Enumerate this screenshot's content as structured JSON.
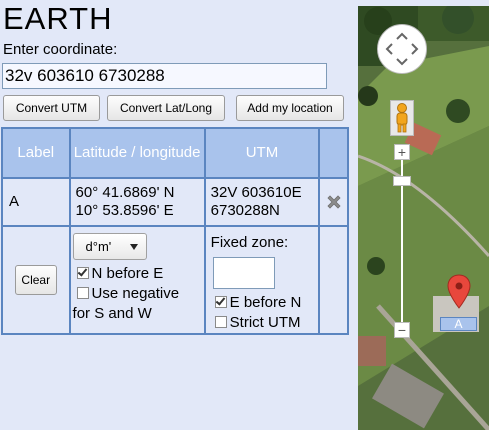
{
  "title": "EARTH",
  "prompt": "Enter coordinate:",
  "coordinate_input": {
    "value": "32v 603610 6730288"
  },
  "buttons": {
    "convert_utm": "Convert UTM",
    "convert_latlong": "Convert Lat/Long",
    "add_location": "Add my location"
  },
  "table": {
    "headers": {
      "label": "Label",
      "latlong": "Latitude / longitude",
      "utm": "UTM"
    },
    "row": {
      "label": "A",
      "lat": "60° 41.6869' N",
      "lon": "10° 53.8596' E",
      "utm_line1": "32V 603610E",
      "utm_line2": "6730288N"
    },
    "options": {
      "clear": "Clear",
      "format_selected": "d°m'",
      "n_before_e": "N before E",
      "use_negative": "Use negative",
      "use_negative_2": "for S and W",
      "fixed_zone": "Fixed zone:",
      "e_before_n": "E before N",
      "strict_utm": "Strict UTM"
    },
    "checks": {
      "n_before_e": true,
      "use_negative": false,
      "e_before_n": true,
      "strict_utm": false
    }
  },
  "map": {
    "marker_label": "A",
    "zoom_in": "+",
    "zoom_out": "−"
  },
  "colors": {
    "header_bg": "#a9c3ec",
    "border": "#5b85c0",
    "page_bg": "#e2e8f8",
    "marker": "#e8473c"
  },
  "icons": [
    "delete-x-icon",
    "pan-control-icon",
    "pegman-icon",
    "map-marker-icon"
  ]
}
